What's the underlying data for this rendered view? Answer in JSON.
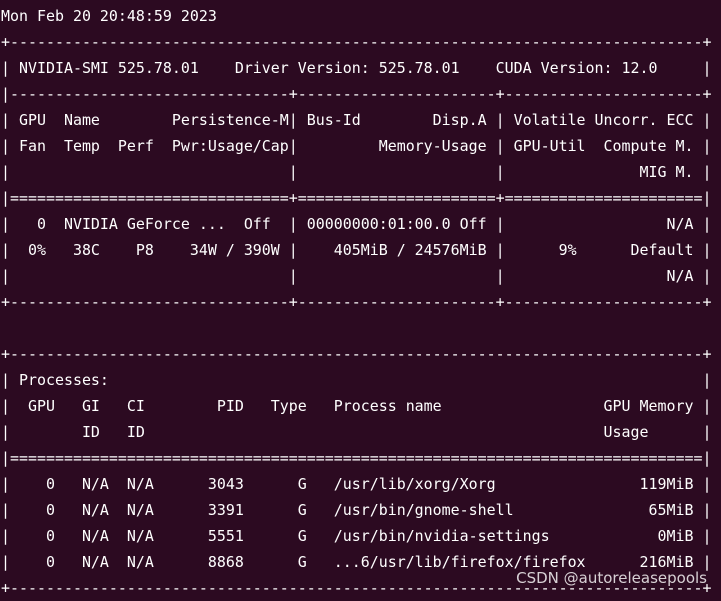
{
  "terminal": {
    "lines": [
      "Mon Feb 20 20:48:59 2023       ",
      "+-----------------------------------------------------------------------------+",
      "| NVIDIA-SMI 525.78.01    Driver Version: 525.78.01    CUDA Version: 12.0     |",
      "|-------------------------------+----------------------+----------------------+",
      "| GPU  Name        Persistence-M| Bus-Id        Disp.A | Volatile Uncorr. ECC |",
      "| Fan  Temp  Perf  Pwr:Usage/Cap|         Memory-Usage | GPU-Util  Compute M. |",
      "|                               |                      |               MIG M. |",
      "|===============================+======================+======================|",
      "|   0  NVIDIA GeForce ...  Off  | 00000000:01:00.0 Off |                  N/A |",
      "|  0%   38C    P8    34W / 390W |    405MiB / 24576MiB |      9%      Default |",
      "|                               |                      |                  N/A |",
      "+-------------------------------+----------------------+----------------------+",
      "                                                                               ",
      "+-----------------------------------------------------------------------------+",
      "| Processes:                                                                  |",
      "|  GPU   GI   CI        PID   Type   Process name                  GPU Memory |",
      "|        ID   ID                                                   Usage      |",
      "|=============================================================================|",
      "|    0   N/A  N/A      3043      G   /usr/lib/xorg/Xorg                119MiB |",
      "|    0   N/A  N/A      3391      G   /usr/bin/gnome-shell               65MiB |",
      "|    0   N/A  N/A      5551      G   /usr/bin/nvidia-settings            0MiB |",
      "|    0   N/A  N/A      8868      G   ...6/usr/lib/firefox/firefox      216MiB |",
      "+-----------------------------------------------------------------------------+"
    ],
    "foreground_color": "#ffffff",
    "background_color": "#2c0a21"
  },
  "watermark": {
    "text": "CSDN @autoreleasepools"
  }
}
